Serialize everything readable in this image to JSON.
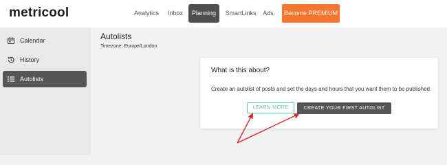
{
  "app": {
    "logo": "metricool"
  },
  "nav": {
    "items": [
      {
        "label": "Analytics"
      },
      {
        "label": "Inbox"
      },
      {
        "label": "Planning"
      },
      {
        "label": "SmartLinks"
      },
      {
        "label": "Ads"
      }
    ],
    "active": "Planning",
    "premium_label": "Become PREMIUM",
    "premium_color": "#f7752c"
  },
  "sidebar": {
    "items": [
      {
        "label": "Calendar",
        "icon": "calendar-icon"
      },
      {
        "label": "History",
        "icon": "history-icon"
      },
      {
        "label": "Autolists",
        "icon": "list-icon"
      }
    ],
    "active": "Autolists"
  },
  "main": {
    "title": "Autolists",
    "timezone": "Timezone: Europe/London"
  },
  "card": {
    "title": "What is this about?",
    "text": "Create an autolist of posts and set the days and hours that you want them to be published.",
    "learn_label": "LEARN MORE",
    "create_label": "CREATE YOUR FIRST AUTOLIST",
    "accent_color": "#5cc4a5"
  },
  "annotation": {
    "arrow_color": "#e0282a"
  }
}
